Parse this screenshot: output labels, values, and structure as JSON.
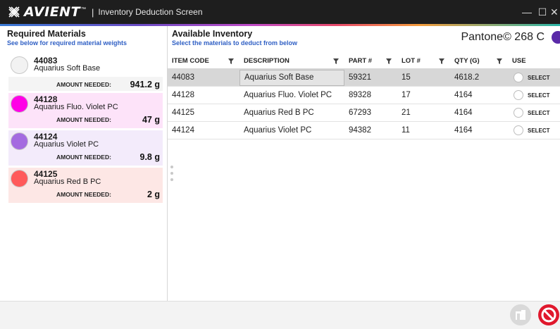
{
  "window": {
    "brand": "AVIENT",
    "brand_tm": "™",
    "separator": "|",
    "title": "Inventory Deduction Screen",
    "minimize_label": "—",
    "maximize_label": "☐",
    "close_label": "✕"
  },
  "required": {
    "title": "Required Materials",
    "subtitle": "See below for required material weights",
    "amount_label": "AMOUNT NEEDED:",
    "items": [
      {
        "code": "44083",
        "name": "Aquarius Soft Base",
        "amount": "941.2 g",
        "color": "#f2f2f2"
      },
      {
        "code": "44128",
        "name": "Aquarius Fluo. Violet PC",
        "amount": "47 g",
        "color": "#ff00e6"
      },
      {
        "code": "44124",
        "name": "Aquarius Violet PC",
        "amount": "9.8 g",
        "color": "#a46be0"
      },
      {
        "code": "44125",
        "name": "Aquarius Red B PC",
        "amount": "2 g",
        "color": "#ff5a5a"
      }
    ]
  },
  "available": {
    "title": "Available Inventory",
    "subtitle": "Select the materials to deduct from below",
    "pantone": "Pantone© 268 C",
    "pantone_color": "#5a2aa8",
    "columns": [
      "ITEM CODE",
      "DESCRIPTION",
      "PART #",
      "LOT #",
      "QTY (G)",
      "USE"
    ],
    "select_label": "SELECT",
    "rows": [
      {
        "code": "44083",
        "description": "Aquarius Soft Base",
        "part": "59321",
        "lot": "15",
        "qty": "4618.2",
        "selected": true
      },
      {
        "code": "44128",
        "description": "Aquarius Fluo. Violet PC",
        "part": "89328",
        "lot": "17",
        "qty": "4164",
        "selected": false
      },
      {
        "code": "44125",
        "description": "Aquarius Red B PC",
        "part": "67293",
        "lot": "21",
        "qty": "4164",
        "selected": false
      },
      {
        "code": "44124",
        "description": "Aquarius Violet PC",
        "part": "94382",
        "lot": "11",
        "qty": "4164",
        "selected": false
      }
    ]
  },
  "footer": {
    "apply_icon": "inventory-deduct-icon",
    "cancel_icon": "cancel-icon",
    "accent_cancel": "#e0182d"
  }
}
